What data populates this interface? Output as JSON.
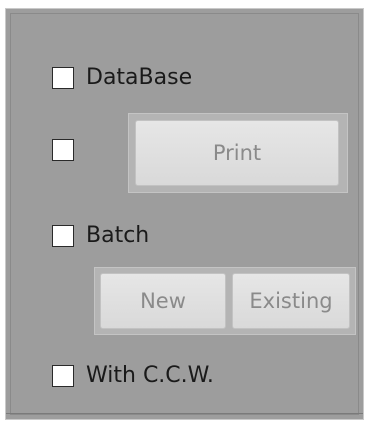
{
  "options": {
    "database": {
      "label": "DataBase",
      "checked": false
    },
    "print_option": {
      "label": "",
      "checked": false
    },
    "batch": {
      "label": "Batch",
      "checked": false
    },
    "with_ccw": {
      "label": "With C.C.W.",
      "checked": false
    }
  },
  "buttons": {
    "print": {
      "label": "Print",
      "enabled": false
    },
    "new": {
      "label": "New",
      "enabled": false
    },
    "existing": {
      "label": "Existing",
      "enabled": false
    }
  }
}
